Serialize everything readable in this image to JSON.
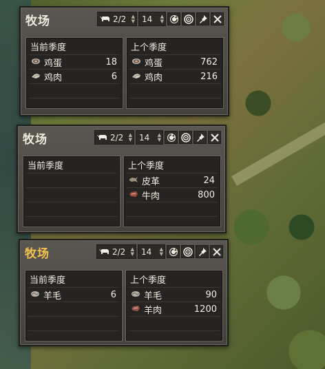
{
  "panels": [
    {
      "title": "牧场",
      "active": false,
      "animals_count": "2/2",
      "quantity": "14",
      "current_label": "当前季度",
      "previous_label": "上个季度",
      "current_items": [
        {
          "name": "鸡蛋",
          "value": "18",
          "icon": "egg-icon"
        },
        {
          "name": "鸡肉",
          "value": "6",
          "icon": "chicken-meat-icon"
        }
      ],
      "previous_items": [
        {
          "name": "鸡蛋",
          "value": "762",
          "icon": "egg-icon"
        },
        {
          "name": "鸡肉",
          "value": "216",
          "icon": "chicken-meat-icon"
        }
      ]
    },
    {
      "title": "牧场",
      "active": false,
      "animals_count": "2/2",
      "quantity": "14",
      "current_label": "当前季度",
      "previous_label": "上个季度",
      "current_items": [],
      "previous_items": [
        {
          "name": "皮革",
          "value": "24",
          "icon": "leather-icon"
        },
        {
          "name": "牛肉",
          "value": "800",
          "icon": "beef-icon"
        }
      ]
    },
    {
      "title": "牧场",
      "active": true,
      "animals_count": "2/2",
      "quantity": "14",
      "current_label": "当前季度",
      "previous_label": "上个季度",
      "current_items": [
        {
          "name": "羊毛",
          "value": "6",
          "icon": "wool-icon"
        }
      ],
      "previous_items": [
        {
          "name": "羊毛",
          "value": "90",
          "icon": "wool-icon"
        },
        {
          "name": "羊肉",
          "value": "1200",
          "icon": "mutton-icon"
        }
      ]
    }
  ],
  "icons": {
    "animal": "cow-icon",
    "refresh": "refresh-icon",
    "target": "target-icon",
    "pin": "pin-icon",
    "close": "close-icon"
  },
  "colors": {
    "active_title": "#f4c34d",
    "title": "#f0ecdf",
    "panel": "#4b4742"
  }
}
